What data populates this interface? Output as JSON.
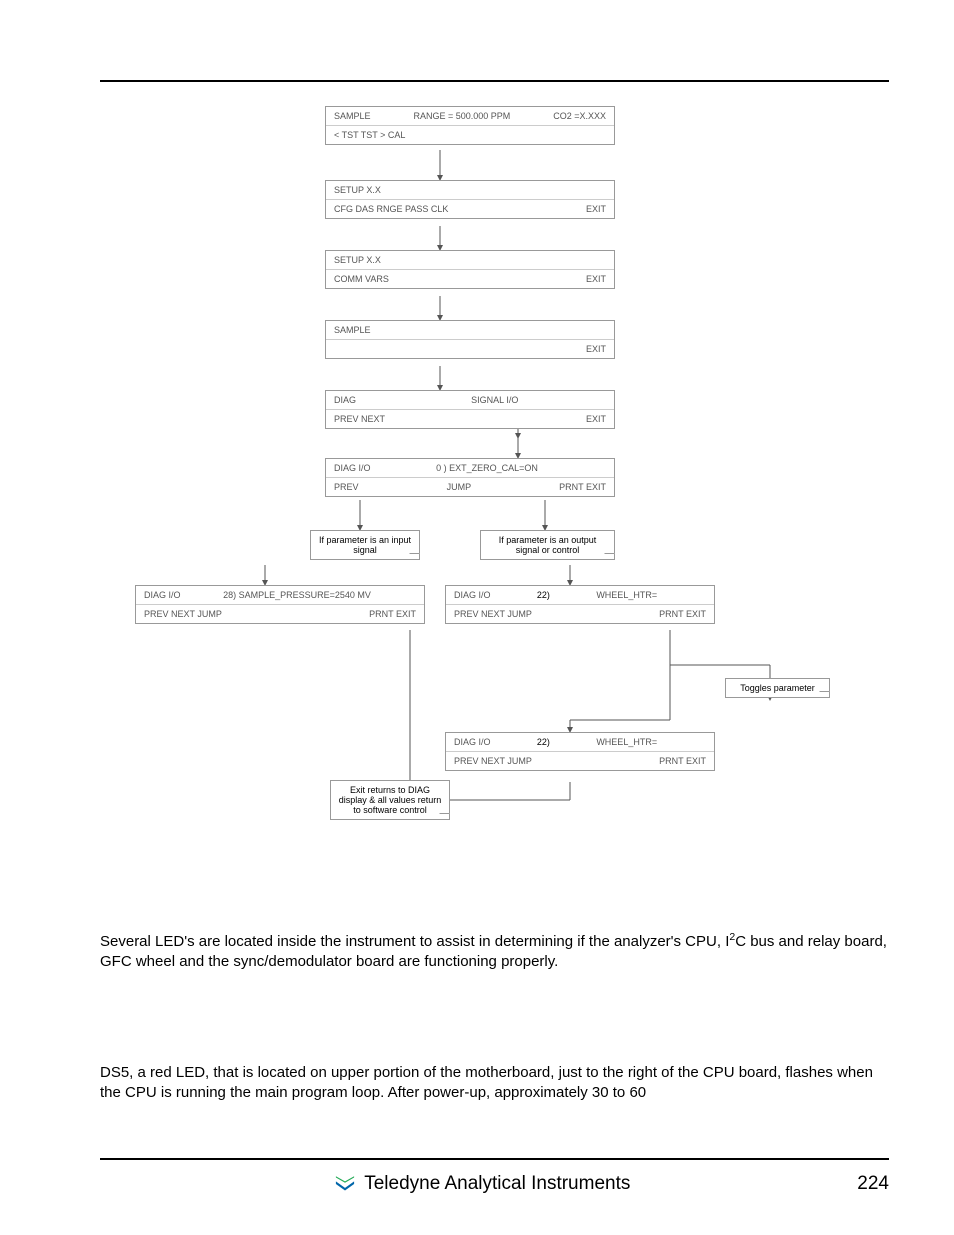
{
  "diagram": {
    "b1": {
      "l": "SAMPLE",
      "c": "RANGE = 500.000 PPM",
      "r": "CO2 =X.XXX",
      "b": "< TST  TST >  CAL"
    },
    "b2": {
      "t": "SETUP X.X",
      "l": "CFG  DAS  RNGE  PASS  CLK",
      "r": "EXIT"
    },
    "b3": {
      "t": "SETUP X.X",
      "l": "COMM  VARS",
      "r": "EXIT"
    },
    "b4": {
      "t": "SAMPLE",
      "r": "EXIT"
    },
    "b5": {
      "l": "DIAG",
      "c": "SIGNAL I/O",
      "bl": "PREV   NEXT",
      "br": "EXIT"
    },
    "b6": {
      "l": "DIAG  I/O",
      "c": "0 )  EXT_ZERO_CAL=ON",
      "bl": "PREV",
      "bc": "JUMP",
      "br": "PRNT EXIT"
    },
    "aux_left": "If parameter is an input signal",
    "aux_right": "If parameter is an output signal or control",
    "b7": {
      "l": "DIAG  I/O",
      "c": "28)  SAMPLE_PRESSURE=2540 MV",
      "bl": "PREV NEXT JUMP",
      "br": "PRNT EXIT"
    },
    "b8": {
      "l": "DIAG I/O",
      "c": "22)",
      "cr": "WHEEL_HTR=",
      "bl": "PREV  NEXT  JUMP",
      "br": "PRNT EXIT"
    },
    "toggle": "Toggles parameter",
    "b9": {
      "l": "DIAG I/O",
      "c": "22)",
      "cr": "WHEEL_HTR=",
      "bl": "PREV  NEXT  JUMP",
      "br": "PRNT EXIT"
    },
    "aux_bottom": "Exit returns to DIAG display & all values return to software control"
  },
  "body": {
    "p1a": "Several LED's are located inside the instrument to assist in determining if the analyzer's CPU, I",
    "p1b": "C bus and relay board, GFC wheel and the sync/demodulator board are functioning properly.",
    "p2": "DS5, a red LED, that is located on upper portion of the motherboard, just to the right of the CPU board, flashes when the CPU is running the main program loop.  After power-up, approximately 30 to 60"
  },
  "footer": {
    "brand": "Teledyne Analytical Instruments",
    "page": "224"
  }
}
